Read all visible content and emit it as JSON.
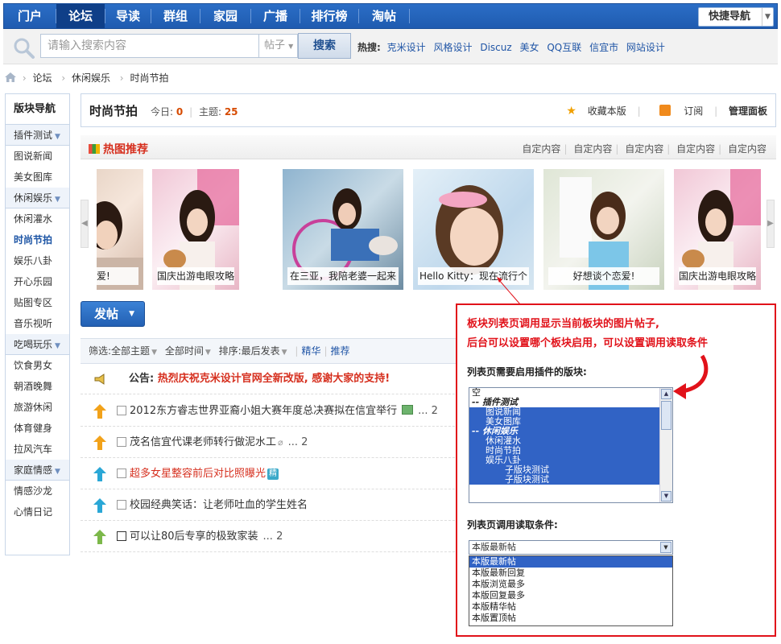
{
  "nav": {
    "items": [
      "门户",
      "论坛",
      "导读",
      "群组",
      "家园",
      "广播",
      "排行榜",
      "淘帖"
    ],
    "active_index": 1,
    "quick_nav": "快捷导航"
  },
  "search": {
    "placeholder": "请输入搜索内容",
    "type": "帖子",
    "button": "搜索",
    "hot_label": "热搜:",
    "hot_keywords": [
      "克米设计",
      "风格设计",
      "Discuz",
      "美女",
      "QQ互联",
      "信宜市",
      "网站设计"
    ]
  },
  "breadcrumb": [
    "论坛",
    "休闲娱乐",
    "时尚节拍"
  ],
  "sidebar": {
    "title": "版块导航",
    "groups": [
      {
        "name": "插件测试",
        "items": [
          "图说新闻",
          "美女图库"
        ]
      },
      {
        "name": "休闲娱乐",
        "items": [
          "休闲灌水",
          "时尚节拍",
          "娱乐八卦",
          "开心乐园",
          "贴图专区",
          "音乐视听"
        ]
      },
      {
        "name": "吃喝玩乐",
        "items": [
          "饮食男女",
          "朝酒晚舞",
          "旅游休闲",
          "体育健身",
          "拉风汽车"
        ]
      },
      {
        "name": "家庭情感",
        "items": [
          "情感沙龙",
          "心情日记"
        ]
      }
    ],
    "current": "时尚节拍"
  },
  "forum": {
    "name": "时尚节拍",
    "today_label": "今日:",
    "today": "0",
    "topics_label": "主题:",
    "topics": "25",
    "favorite": "收藏本版",
    "subscribe": "订阅",
    "manage": "管理面板"
  },
  "hotpics": {
    "title": "热图推荐",
    "links": [
      "自定内容",
      "自定内容",
      "自定内容",
      "自定内容",
      "自定内容"
    ],
    "captions": [
      "爱!",
      "国庆出游电眼攻略",
      "在三亚，我陪老婆一起来",
      "Hello Kitty：现在流行个",
      "好想谈个恋爱!",
      "国庆出游电眼攻略"
    ]
  },
  "post_button": "发帖",
  "filter": {
    "label": "筛选:",
    "all_topics": "全部主题",
    "all_time": "全部时间",
    "sort_label": "排序:",
    "sort": "最后发表",
    "digest": "精华",
    "recommend": "推荐"
  },
  "threads": {
    "announcement_label": "公告:",
    "announcement": "热烈庆祝克米设计官网全新改版, 感谢大家的支持!",
    "rows": [
      {
        "title": "2012东方睿志世界亚裔小姐大赛年度总决赛拟在信宜举行",
        "pages": "... 2"
      },
      {
        "title": "茂名信宜代课老师转行做泥水工",
        "pages": "... 2"
      },
      {
        "title": "超多女星整容前后对比照曝光",
        "badge": "精"
      },
      {
        "title": "校园经典笑话：让老师吐血的学生姓名"
      },
      {
        "title": "可以让80后专享的极致家装",
        "pages": "... 2"
      }
    ]
  },
  "callout": {
    "line1": "板块列表页调用显示当前板块的图片帖子,",
    "line2": "后台可以设置哪个板块启用，可以设置调用读取条件",
    "enable_label": "列表页需要启用插件的版块:",
    "listbox": [
      {
        "text": "空",
        "type": "plain"
      },
      {
        "text": "-- 插件测试",
        "type": "group"
      },
      {
        "text": "图说新闻",
        "type": "sel1"
      },
      {
        "text": "美女图库",
        "type": "sel1"
      },
      {
        "text": "-- 休闲娱乐",
        "type": "groupsel"
      },
      {
        "text": "休闲灌水",
        "type": "sel1"
      },
      {
        "text": "时尚节拍",
        "type": "sel1"
      },
      {
        "text": "娱乐八卦",
        "type": "sel1"
      },
      {
        "text": "子版块测试",
        "type": "sel2"
      },
      {
        "text": "子版块测试",
        "type": "sel2"
      }
    ],
    "condition_label": "列表页调用读取条件:",
    "select_value": "本版最新帖",
    "options": [
      "本版最新帖",
      "本版最新回复",
      "本版浏览最多",
      "本版回复最多",
      "本版精华帖",
      "本版置顶帖"
    ]
  }
}
